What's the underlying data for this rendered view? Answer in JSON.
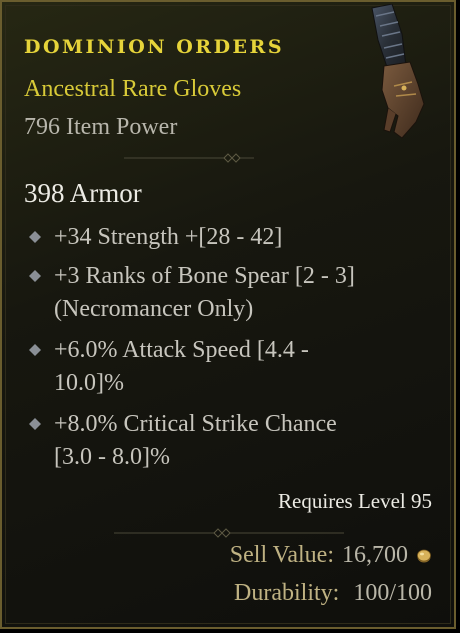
{
  "item": {
    "name": "DOMINION ORDERS",
    "type": "Ancestral Rare Gloves",
    "item_power": "796 Item Power",
    "icon": "glove-icon"
  },
  "stats": {
    "armor": "398 Armor"
  },
  "affixes": [
    {
      "line1": "+34 Strength +[28 - 42]",
      "line2": ""
    },
    {
      "line1": "+3 Ranks of Bone Spear [2 - 3]",
      "line2": "(Necromancer Only)"
    },
    {
      "line1": "+6.0% Attack Speed [4.4 -",
      "line2": "10.0]%"
    },
    {
      "line1": "+8.0% Critical Strike Chance",
      "line2": "[3.0 - 8.0]%"
    }
  ],
  "requirements": {
    "level": "Requires Level 95"
  },
  "footer": {
    "sell_label": "Sell Value:",
    "sell_value": "16,700",
    "durability_label": "Durability:",
    "durability_value": "100/100"
  },
  "colors": {
    "rare_name": "#e6d43a",
    "rare_type": "#d8ca38",
    "border": "#6a5d2e"
  }
}
